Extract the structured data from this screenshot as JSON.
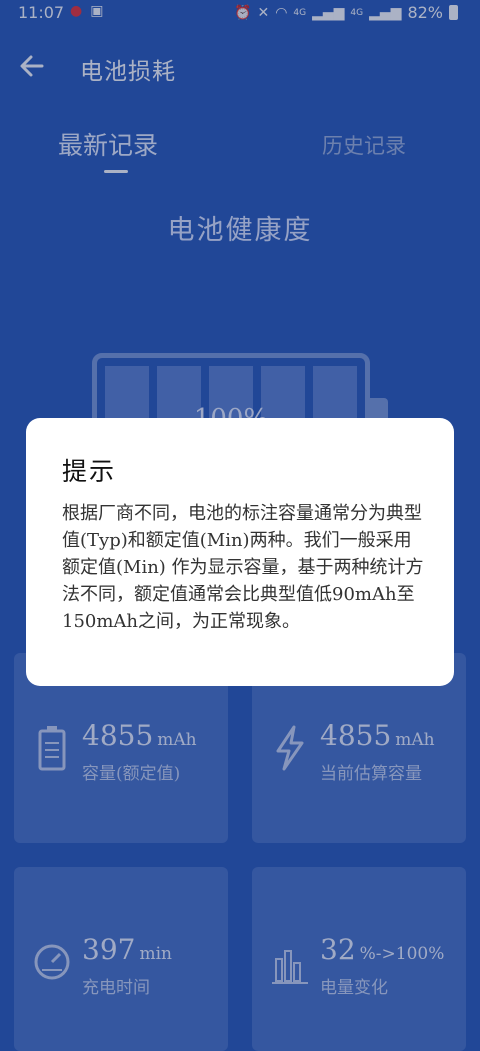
{
  "statusbar": {
    "time": "11:07",
    "battery": "82%",
    "net1": "4G",
    "net2": "4G"
  },
  "appbar": {
    "title": "电池损耗"
  },
  "tabs": [
    {
      "label": "最新记录"
    },
    {
      "label": "历史记录"
    }
  ],
  "health": {
    "title": "电池健康度",
    "percent": "100%"
  },
  "cards": [
    {
      "value": "4855",
      "unit": "mAh",
      "label": "容量(额定值)",
      "icon": "battery-icon"
    },
    {
      "value": "4855",
      "unit": "mAh",
      "label": "当前估算容量",
      "icon": "lightning-icon"
    },
    {
      "value": "397",
      "unit": "min",
      "label": "充电时间",
      "icon": "gauge-icon"
    },
    {
      "value": "32",
      "unit": "%->100%",
      "label": "电量变化",
      "icon": "bar-chart-icon"
    }
  ],
  "dialog": {
    "title": "提示",
    "body": "根据厂商不同，电池的标注容量通常分为典型值(Typ)和额定值(Min)两种。我们一般采用额定值(Min) 作为显示容量，基于两种统计方法不同，额定值通常会比典型值低90mAh至150mAh之间，为正常现象。"
  }
}
